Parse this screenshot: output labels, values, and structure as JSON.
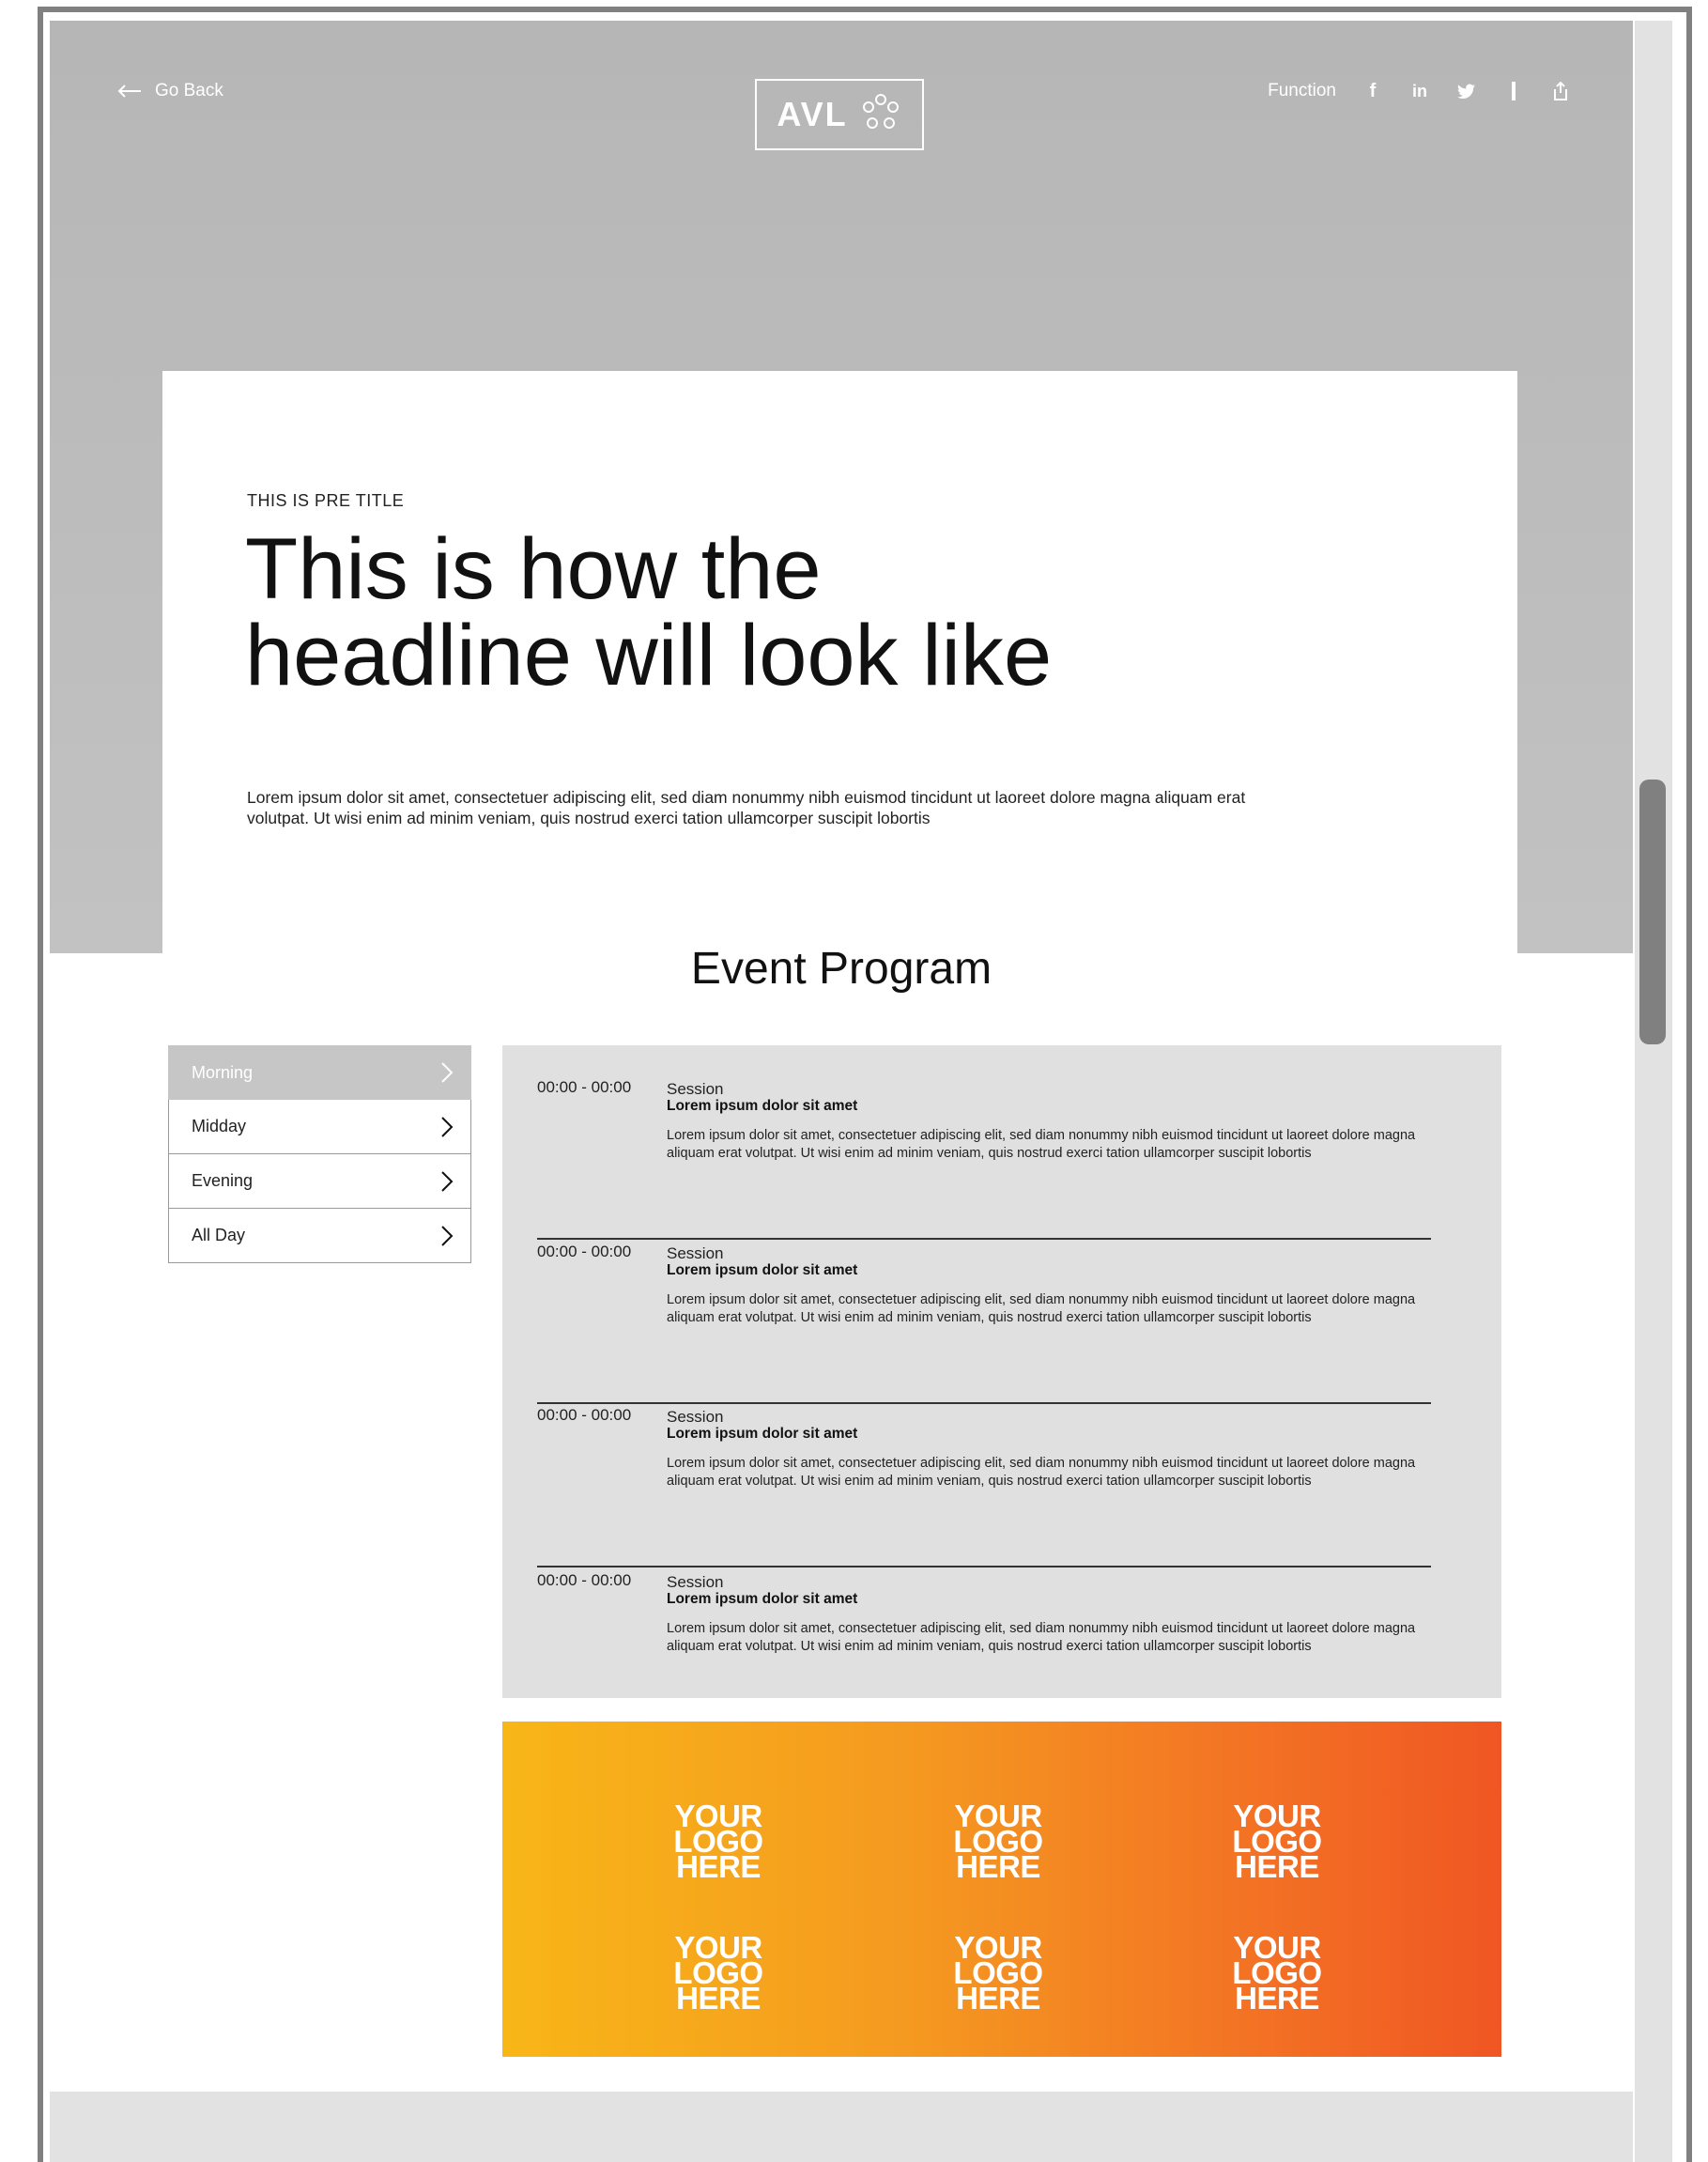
{
  "header": {
    "back_label": "Go Back",
    "logo_text": "AVL",
    "function_label": "Function",
    "social_icons": [
      "facebook-icon",
      "linkedin-icon",
      "twitter-icon",
      "divider-icon",
      "share-icon"
    ]
  },
  "hero": {
    "pretitle": "THIS IS PRE TITLE",
    "headline_line1": "This is how the",
    "headline_line2": "headline will look like",
    "intro": "Lorem ipsum dolor sit amet, consectetuer adipiscing elit, sed diam nonummy nibh euismod tincidunt ut laoreet dolore magna aliquam erat volutpat. Ut wisi enim ad minim veniam, quis nostrud exerci tation ullamcorper suscipit lobortis"
  },
  "program": {
    "title": "Event Program",
    "tabs": [
      {
        "label": "Morning",
        "active": true
      },
      {
        "label": "Midday",
        "active": false
      },
      {
        "label": "Evening",
        "active": false
      },
      {
        "label": "All Day",
        "active": false
      }
    ],
    "sessions": [
      {
        "time": "00:00 - 00:00",
        "label": "Session",
        "name": "Lorem ipsum dolor sit amet",
        "desc": "Lorem ipsum dolor sit amet, consectetuer adipiscing elit, sed diam nonummy nibh euismod tincidunt ut laoreet dolore magna aliquam erat volutpat. Ut wisi enim ad minim veniam, quis nostrud exerci tation ullamcorper suscipit lobortis"
      },
      {
        "time": "00:00 - 00:00",
        "label": "Session",
        "name": "Lorem ipsum dolor sit amet",
        "desc": "Lorem ipsum dolor sit amet, consectetuer adipiscing elit, sed diam nonummy nibh euismod tincidunt ut laoreet dolore magna aliquam erat volutpat. Ut wisi enim ad minim veniam, quis nostrud exerci tation ullamcorper suscipit lobortis"
      },
      {
        "time": "00:00 - 00:00",
        "label": "Session",
        "name": "Lorem ipsum dolor sit amet",
        "desc": "Lorem ipsum dolor sit amet, consectetuer adipiscing elit, sed diam nonummy nibh euismod tincidunt ut laoreet dolore magna aliquam erat volutpat. Ut wisi enim ad minim veniam, quis nostrud exerci tation ullamcorper suscipit lobortis"
      },
      {
        "time": "00:00 - 00:00",
        "label": "Session",
        "name": "Lorem ipsum dolor sit amet",
        "desc": "Lorem ipsum dolor sit amet, consectetuer adipiscing elit, sed diam nonummy nibh euismod tincidunt ut laoreet dolore magna aliquam erat volutpat. Ut wisi enim ad minim veniam, quis nostrud exerci tation ullamcorper suscipit lobortis"
      }
    ]
  },
  "sponsors": {
    "logos": [
      {
        "line1": "YOUR",
        "line2": "LOGO",
        "line3": "HERE"
      },
      {
        "line1": "YOUR",
        "line2": "LOGO",
        "line3": "HERE"
      },
      {
        "line1": "YOUR",
        "line2": "LOGO",
        "line3": "HERE"
      },
      {
        "line1": "YOUR",
        "line2": "LOGO",
        "line3": "HERE"
      },
      {
        "line1": "YOUR",
        "line2": "LOGO",
        "line3": "HERE"
      },
      {
        "line1": "YOUR",
        "line2": "LOGO",
        "line3": "HERE"
      }
    ]
  },
  "colors": {
    "hero_gray": "#b8b8b8",
    "program_bg": "#e0e0e0",
    "gradient_start": "#f8b617",
    "gradient_end": "#f05623",
    "active_tab": "#c6c6c6"
  }
}
